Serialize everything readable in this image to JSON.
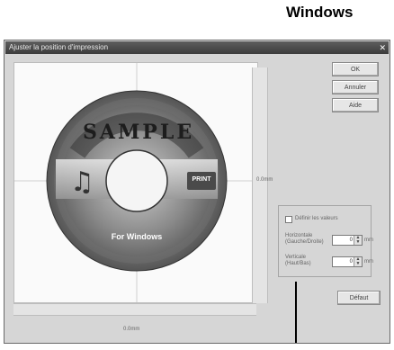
{
  "heading": "Windows",
  "dialog": {
    "title": "Ajuster la position d'impression",
    "close_icon": "close-icon",
    "buttons": {
      "ok": "OK",
      "cancel": "Annuler",
      "help": "Aide",
      "default": "Défaut"
    },
    "ruler_right_label": "0.0mm",
    "ruler_bottom_label": "0.0mm",
    "options": {
      "checkbox_label": "Définir les valeurs",
      "horizontal_label": "Horizontale (Gauche/Droite)",
      "horizontal_value": "0",
      "vertical_label": "Verticale (Haut/Bas)",
      "vertical_value": "0",
      "unit": "mm"
    },
    "disc": {
      "sample_text": "SAMPLE",
      "label_text": "For Windows",
      "badge_text": "PRINT"
    }
  }
}
